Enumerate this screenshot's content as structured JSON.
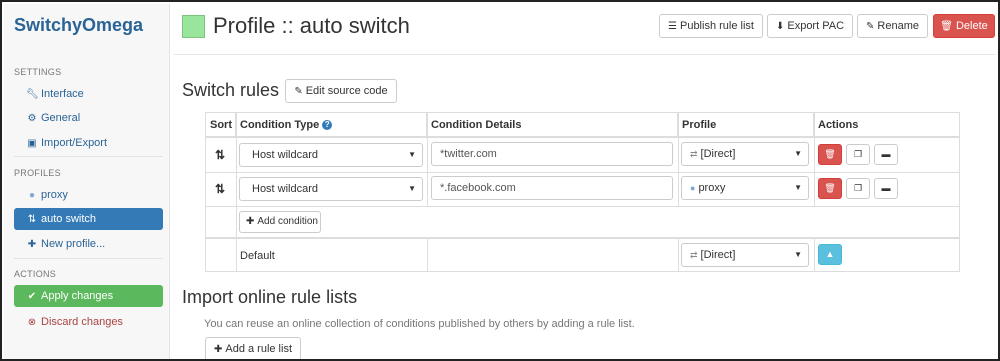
{
  "app": {
    "brand": "SwitchyOmega"
  },
  "sidebar": {
    "settings_header": "SETTINGS",
    "settings": [
      {
        "label": "Interface",
        "icon": "wrench-icon"
      },
      {
        "label": "General",
        "icon": "gear-icon"
      },
      {
        "label": "Import/Export",
        "icon": "floppy-icon"
      }
    ],
    "profiles_header": "PROFILES",
    "profiles": [
      {
        "label": "proxy",
        "icon": "globe-icon"
      },
      {
        "label": "auto switch",
        "icon": "retweet-icon",
        "active": true
      },
      {
        "label": "New profile...",
        "icon": "plus-icon"
      }
    ],
    "actions_header": "ACTIONS",
    "apply_label": "Apply changes",
    "discard_label": "Discard changes"
  },
  "header": {
    "title": "Profile :: auto switch",
    "color": "#99e59c",
    "publish_label": "Publish rule list",
    "export_label": "Export PAC",
    "rename_label": "Rename",
    "delete_label": "Delete"
  },
  "switch_rules": {
    "title": "Switch rules",
    "edit_source_label": "Edit source code",
    "columns": [
      "Sort",
      "Condition Type",
      "Condition Details",
      "Profile",
      "Actions"
    ],
    "rows": [
      {
        "condition_type": "Host wildcard",
        "details": "*twitter.com",
        "profile": "[Direct]",
        "profile_icon": "transfer-icon"
      },
      {
        "condition_type": "Host wildcard",
        "details": "*.facebook.com",
        "profile": "proxy",
        "profile_icon": "globe-icon"
      }
    ],
    "add_condition_label": "Add condition",
    "default_label": "Default",
    "default_profile": "[Direct]"
  },
  "import": {
    "title": "Import online rule lists",
    "help": "You can reuse an online collection of conditions published by others by adding a rule list.",
    "add_label": "Add a rule list"
  }
}
